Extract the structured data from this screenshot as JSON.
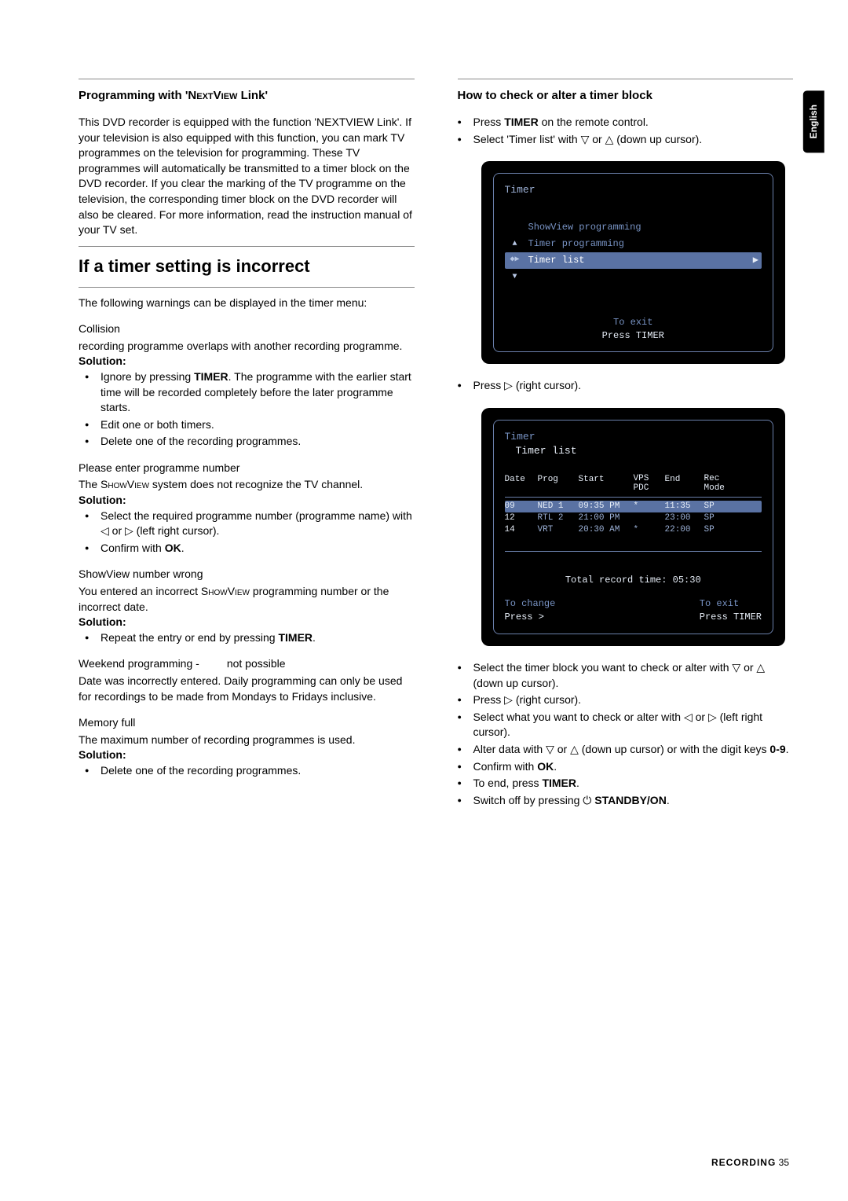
{
  "sidebar": {
    "label": "English"
  },
  "left": {
    "title1": "Programming with 'NEXTVIEW Link'",
    "desc1": "This DVD recorder is equipped with the function 'NEXTVIEW Link'. If your television is also equipped with this function, you can mark TV programmes on the television for programming. These TV programmes will automatically be transmitted to a timer block on the DVD recorder. If you clear the marking of the TV programme on the television, the corresponding timer block on the DVD recorder will also be cleared. For more information, read the instruction manual of your TV set.",
    "heading_big": "If a timer setting is incorrect",
    "warn_intro": "The following warnings can be displayed in the timer menu:",
    "collision": {
      "title": "Collision",
      "text": "recording programme overlaps with another recording programme.",
      "solution_label": "Solution:",
      "items": [
        "Ignore by pressing TIMER. The programme with the earlier start time will be recorded completely before the later programme starts.",
        "Edit one or both timers.",
        "Delete one of the recording programmes."
      ]
    },
    "please_enter": {
      "title": "Please enter programme number",
      "text": "The SHOWVIEW system does not recognize the TV channel.",
      "solution_label": "Solution:",
      "items": [
        "Select the required programme number (programme name) with ◁ or ▷  (left right cursor).",
        "Confirm with OK."
      ]
    },
    "showview_wrong": {
      "title": "ShowView number wrong",
      "text": "You entered an incorrect SHOWVIEW programming number or the incorrect date.",
      "solution_label": "Solution:",
      "items": [
        "Repeat the entry or end by pressing TIMER."
      ]
    },
    "weekend": {
      "title": "Weekend programming -         not possible",
      "text": "Date was incorrectly entered. Daily programming can only be used for recordings to be made from Mondays to Fridays inclusive."
    },
    "memory": {
      "title": "Memory full",
      "text": "The maximum number of recording programmes is used.",
      "solution_label": "Solution:",
      "items": [
        "Delete one of the recording programmes."
      ]
    }
  },
  "right": {
    "title": "How to check or alter a timer block",
    "steps1": [
      "Press TIMER on the remote control.",
      "Select 'Timer list' with ▽ or △ (down up cursor)."
    ],
    "osd1": {
      "title": "Timer",
      "items": [
        "ShowView programming",
        "Timer programming",
        "Timer list"
      ],
      "exit1": "To exit",
      "exit2": "Press TIMER"
    },
    "step2": "Press ▷ (right cursor).",
    "osd2": {
      "crumb1": "Timer",
      "crumb2": "Timer list",
      "cols": {
        "date": "Date",
        "prog": "Prog",
        "start": "Start",
        "vps": "VPS PDC",
        "end": "End",
        "rec": "Rec Mode"
      },
      "rows": [
        {
          "date": "09",
          "prog": "NED 1",
          "start": "09:35 PM",
          "vps": "*",
          "end": "11:35",
          "rec": "SP"
        },
        {
          "date": "12",
          "prog": "RTL 2",
          "start": "21:00 PM",
          "vps": "",
          "end": "23:00",
          "rec": "SP"
        },
        {
          "date": "14",
          "prog": "VRT",
          "start": "20:30 AM",
          "vps": "*",
          "end": "22:00",
          "rec": "SP"
        }
      ],
      "total": "Total record time: 05:30",
      "change1": "To change",
      "change2": "Press   >",
      "exit1": "To exit",
      "exit2": "Press TIMER"
    },
    "steps3": [
      "Select the timer block you want to check or alter with ▽ or △ (down up cursor).",
      "Press ▷  (right cursor).",
      "Select what you want to check or alter with ◁ or ▷ (left right cursor).",
      "Alter data with ▽ or △ (down up cursor) or with the digit keys 0-9.",
      "Confirm with OK.",
      "To end, press TIMER.",
      "Switch off by pressing ⏻ STANDBY/ON."
    ]
  },
  "footer": {
    "section": "RECORDING",
    "page": "35"
  }
}
